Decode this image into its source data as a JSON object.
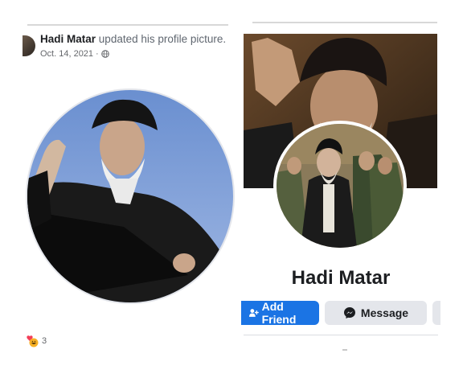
{
  "post": {
    "author": "Hadi Matar",
    "action": "updated his profile picture.",
    "date": "Oct. 14, 2021",
    "date_separator": "·",
    "privacy_icon": "globe-icon",
    "reaction_icon": "laugh-heart-reaction-icon",
    "reaction_count": "3"
  },
  "profile": {
    "name": "Hadi Matar",
    "add_friend_label": "Add Friend",
    "add_friend_icon": "add-friend-icon",
    "message_label": "Message",
    "message_icon": "messenger-icon"
  },
  "colors": {
    "primary_button": "#1b74e4",
    "secondary_button": "#e4e6eb",
    "text_primary": "#1c1e21",
    "text_secondary": "#65676b"
  }
}
